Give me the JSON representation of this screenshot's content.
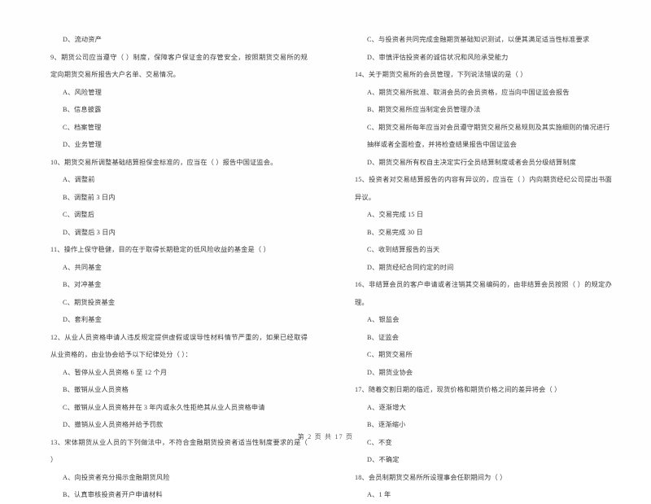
{
  "document": {
    "type": "exam-paper",
    "language": "zh-CN",
    "footer": "第 2 页 共 17 页"
  },
  "columns": {
    "left": [
      {
        "kind": "option",
        "text": "D、流动资产"
      },
      {
        "kind": "stem",
        "text": "9、期货公司应当遵守（    ）制度，保障客户保证金的存管安全，按照期货交易所的规定向期货交易所报告大户名单、交易情况。"
      },
      {
        "kind": "option",
        "text": "A、风险管理"
      },
      {
        "kind": "option",
        "text": "B、信息披露"
      },
      {
        "kind": "option",
        "text": "C、档案管理"
      },
      {
        "kind": "option",
        "text": "D、业务管理"
      },
      {
        "kind": "stem",
        "text": "10、期货交易所调整基础结算担保金标准的，应当在（    ）报告中国证监会。"
      },
      {
        "kind": "option",
        "text": "A、调整前"
      },
      {
        "kind": "option",
        "text": "B、调整前 3 日内"
      },
      {
        "kind": "option",
        "text": "C、调整后"
      },
      {
        "kind": "option",
        "text": "D、调整后 3 日内"
      },
      {
        "kind": "stem",
        "text": "11、操作上保守稳健，目的在于取得长期稳定的低风险收益的基金是（    ）"
      },
      {
        "kind": "option",
        "text": "A、共同基金"
      },
      {
        "kind": "option",
        "text": "B、对冲基金"
      },
      {
        "kind": "option",
        "text": "C、期货投资基金"
      },
      {
        "kind": "option",
        "text": "D、套利基金"
      },
      {
        "kind": "stem",
        "text": "12、从业人员资格申请人违反规定提供虚假或误导性材料情节严重的，如果已经取得从业资格的，由业协会给予以下纪律处分（    ）："
      },
      {
        "kind": "option",
        "text": "A、暂停从业人员资格 6 至 12 个月"
      },
      {
        "kind": "option",
        "text": "B、撤销从业人员资格"
      },
      {
        "kind": "option",
        "text": "C、撤销从业人员资格并在 3 年内或永久性拒绝其从业人员资格申请"
      },
      {
        "kind": "option",
        "text": "D、撤销从业人员资格并给予罚款"
      },
      {
        "kind": "stem",
        "text": "13、宋体期货从业人员的下列做法中，不符合金融期货投资者适当性制度要求的是（    ）"
      },
      {
        "kind": "option",
        "text": "A、向投资者充分揭示金融期货风险"
      },
      {
        "kind": "option",
        "text": "B、认真审核投资者开户申请材料"
      }
    ],
    "right": [
      {
        "kind": "option",
        "text": "C、与投资者共同完成金融期货基础知识测试，以便其满足适当性标准要求"
      },
      {
        "kind": "option",
        "text": "D、审慎评估投资者的诚信状况和风险承受能力"
      },
      {
        "kind": "stem",
        "text": "14、关于期货交易所的会员管理，下列说法错误的是（    ）"
      },
      {
        "kind": "option",
        "text": "A、期货交易所批准、取消会员的会员资格，应当向中国证监会报告"
      },
      {
        "kind": "option",
        "text": "B、期货交易所应当制定会员管理办法"
      },
      {
        "kind": "option-wrap",
        "text": "C、期货交易所每年应当对会员遵守期货交易所交易规则及其实施细则的情况进行抽样或者全面检查，并将检查结果报告中国证监会"
      },
      {
        "kind": "option",
        "text": "D、期货交易所有权自主决定实行全员结算制度或者会员分级结算制度"
      },
      {
        "kind": "stem",
        "text": "15、投资者对交易结算报告的内容有异议的，应当在（    ）内向期货经纪公司提出书面异议。"
      },
      {
        "kind": "option",
        "text": "A、交易完成 15 日"
      },
      {
        "kind": "option",
        "text": "B、交易完成 30 日"
      },
      {
        "kind": "option",
        "text": "C、收到结算报告的当天"
      },
      {
        "kind": "option",
        "text": "D、期货经纪合同约定的时间"
      },
      {
        "kind": "stem",
        "text": "16、非结算会员的客户申请或者注销其交易编码的，由非结算会员按照（    ）的规定办理。"
      },
      {
        "kind": "option",
        "text": "A、银监会"
      },
      {
        "kind": "option",
        "text": "B、证监会"
      },
      {
        "kind": "option",
        "text": "C、期货交易所"
      },
      {
        "kind": "option",
        "text": "D、期货业协会"
      },
      {
        "kind": "stem",
        "text": "17、随着交割日期的临近，现货价格和期货价格之间的差异将会（    ）"
      },
      {
        "kind": "option",
        "text": "A、逐渐增大"
      },
      {
        "kind": "option",
        "text": "B、逐渐缩小"
      },
      {
        "kind": "option",
        "text": "C、不变"
      },
      {
        "kind": "option",
        "text": "D、不确定"
      },
      {
        "kind": "stem",
        "text": "18、会员制期货交易所所设理事会任职期间为（    ）"
      },
      {
        "kind": "option",
        "text": "A、1 年"
      }
    ]
  }
}
